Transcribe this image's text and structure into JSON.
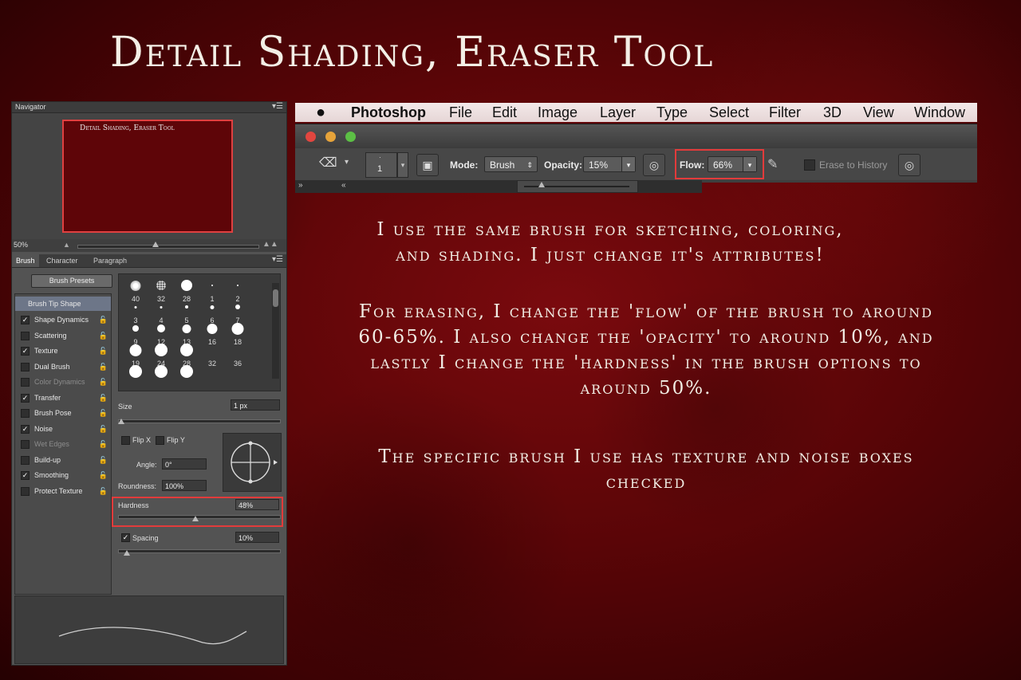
{
  "title": "Detail Shading, Eraser Tool",
  "navigator": {
    "title": "Navigator",
    "thumb_text": "Detail Shading, Eraser Tool",
    "zoom": "50%"
  },
  "tabs": [
    "Brush",
    "Character",
    "Paragraph"
  ],
  "brush": {
    "presets_label": "Brush Presets",
    "options": [
      {
        "label": "Brush Tip Shape",
        "mark": ""
      },
      {
        "label": "Shape Dynamics",
        "mark": "✓"
      },
      {
        "label": "Scattering",
        "mark": ""
      },
      {
        "label": "Texture",
        "mark": "✓"
      },
      {
        "label": "Dual Brush",
        "mark": ""
      },
      {
        "label": "Color Dynamics",
        "mark": ""
      },
      {
        "label": "Transfer",
        "mark": "✓"
      },
      {
        "label": "Brush Pose",
        "mark": ""
      },
      {
        "label": "Noise",
        "mark": "✓"
      },
      {
        "label": "Wet Edges",
        "mark": ""
      },
      {
        "label": "Build-up",
        "mark": ""
      },
      {
        "label": "Smoothing",
        "mark": "✓"
      },
      {
        "label": "Protect Texture",
        "mark": ""
      }
    ],
    "tips": [
      {
        "size": "40",
        "d": 13,
        "soft": true
      },
      {
        "size": "32",
        "d": 12,
        "spray": true
      },
      {
        "size": "28",
        "d": 14
      },
      {
        "size": "1",
        "d": 2
      },
      {
        "size": "2",
        "d": 2
      },
      {
        "size": "3",
        "d": 3
      },
      {
        "size": "4",
        "d": 3
      },
      {
        "size": "5",
        "d": 4
      },
      {
        "size": "6",
        "d": 5
      },
      {
        "size": "7",
        "d": 6
      },
      {
        "size": "9",
        "d": 8
      },
      {
        "size": "12",
        "d": 10
      },
      {
        "size": "13",
        "d": 11
      },
      {
        "size": "16",
        "d": 13
      },
      {
        "size": "18",
        "d": 15
      },
      {
        "size": "19",
        "d": 15
      },
      {
        "size": "24",
        "d": 16
      },
      {
        "size": "28",
        "d": 16
      },
      {
        "size": "32",
        "d": 0
      },
      {
        "size": "36",
        "d": 0
      },
      {
        "size": "",
        "d": 16
      },
      {
        "size": "",
        "d": 16
      },
      {
        "size": "",
        "d": 16
      },
      {
        "size": "",
        "d": 0
      },
      {
        "size": "",
        "d": 0
      }
    ],
    "size_label": "Size",
    "size_value": "1 px",
    "flip_x": "Flip X",
    "flip_y": "Flip Y",
    "angle_label": "Angle:",
    "angle_value": "0°",
    "roundness_label": "Roundness:",
    "roundness_value": "100%",
    "hardness_label": "Hardness",
    "hardness_value": "48%",
    "hardness_fraction": 0.48,
    "spacing_mark": "✓",
    "spacing_label": "Spacing",
    "spacing_value": "10%"
  },
  "menubar": [
    "Photoshop",
    "File",
    "Edit",
    "Image",
    "Layer",
    "Type",
    "Select",
    "Filter",
    "3D",
    "View",
    "Window"
  ],
  "options_bar": {
    "brush_size": "1",
    "mode_label": "Mode:",
    "mode_value": "Brush",
    "opacity_label": "Opacity:",
    "opacity_value": "15%",
    "flow_label": "Flow:",
    "flow_value": "66%",
    "erase_history_label": "Erase to History"
  },
  "notes": [
    "I use the same brush for sketching, coloring,\nand shading. I just change it's attributes!",
    "For erasing, I change the 'flow' of the brush to around\n60-65%. I also change the 'opacity' to around 10%, and\nlastly I change the 'hardness' in the brush options to\naround 50%.",
    "The specific brush I use has texture and noise boxes\nchecked"
  ]
}
